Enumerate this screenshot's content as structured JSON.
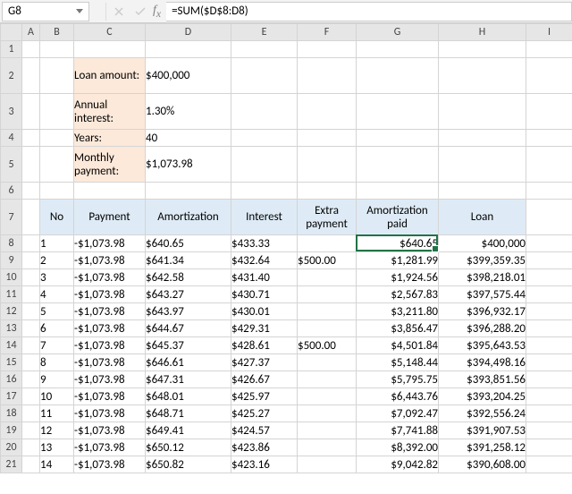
{
  "name_box": "G8",
  "formula": "=SUM($D$8:D8)",
  "col_hdrs": [
    "A",
    "B",
    "C",
    "D",
    "E",
    "F",
    "G",
    "H",
    "I"
  ],
  "summary": {
    "loan_amount_label": "Loan amount:",
    "loan_amount": "$400,000",
    "annual_interest_label": "Annual interest:",
    "annual_interest": "1.30%",
    "years_label": "Years:",
    "years": "40",
    "monthly_payment_label": "Monthly payment:",
    "monthly_payment": "$1,073.98"
  },
  "headers": {
    "no": "No",
    "payment": "Payment",
    "amortization": "Amortization",
    "interest": "Interest",
    "extra_payment": "Extra payment",
    "amortization_paid": "Amortization paid",
    "loan": "Loan"
  },
  "rows": [
    {
      "r": "8",
      "no": "1",
      "payment": "-$1,073.98",
      "amort": "$640.65",
      "interest": "$433.33",
      "extra": "",
      "paid": "$640.65",
      "loan": "$400,000"
    },
    {
      "r": "9",
      "no": "2",
      "payment": "-$1,073.98",
      "amort": "$641.34",
      "interest": "$432.64",
      "extra": "$500.00",
      "paid": "$1,281.99",
      "loan": "$399,359.35"
    },
    {
      "r": "10",
      "no": "3",
      "payment": "-$1,073.98",
      "amort": "$642.58",
      "interest": "$431.40",
      "extra": "",
      "paid": "$1,924.56",
      "loan": "$398,218.01"
    },
    {
      "r": "11",
      "no": "4",
      "payment": "-$1,073.98",
      "amort": "$643.27",
      "interest": "$430.71",
      "extra": "",
      "paid": "$2,567.83",
      "loan": "$397,575.44"
    },
    {
      "r": "12",
      "no": "5",
      "payment": "-$1,073.98",
      "amort": "$643.97",
      "interest": "$430.01",
      "extra": "",
      "paid": "$3,211.80",
      "loan": "$396,932.17"
    },
    {
      "r": "13",
      "no": "6",
      "payment": "-$1,073.98",
      "amort": "$644.67",
      "interest": "$429.31",
      "extra": "",
      "paid": "$3,856.47",
      "loan": "$396,288.20"
    },
    {
      "r": "14",
      "no": "7",
      "payment": "-$1,073.98",
      "amort": "$645.37",
      "interest": "$428.61",
      "extra": "$500.00",
      "paid": "$4,501.84",
      "loan": "$395,643.53"
    },
    {
      "r": "15",
      "no": "8",
      "payment": "-$1,073.98",
      "amort": "$646.61",
      "interest": "$427.37",
      "extra": "",
      "paid": "$5,148.44",
      "loan": "$394,498.16"
    },
    {
      "r": "16",
      "no": "9",
      "payment": "-$1,073.98",
      "amort": "$647.31",
      "interest": "$426.67",
      "extra": "",
      "paid": "$5,795.75",
      "loan": "$393,851.56"
    },
    {
      "r": "17",
      "no": "10",
      "payment": "-$1,073.98",
      "amort": "$648.01",
      "interest": "$425.97",
      "extra": "",
      "paid": "$6,443.76",
      "loan": "$393,204.25"
    },
    {
      "r": "18",
      "no": "11",
      "payment": "-$1,073.98",
      "amort": "$648.71",
      "interest": "$425.27",
      "extra": "",
      "paid": "$7,092.47",
      "loan": "$392,556.24"
    },
    {
      "r": "19",
      "no": "12",
      "payment": "-$1,073.98",
      "amort": "$649.41",
      "interest": "$424.57",
      "extra": "",
      "paid": "$7,741.88",
      "loan": "$391,907.53"
    },
    {
      "r": "20",
      "no": "13",
      "payment": "-$1,073.98",
      "amort": "$650.12",
      "interest": "$423.86",
      "extra": "",
      "paid": "$8,392.00",
      "loan": "$391,258.12"
    },
    {
      "r": "21",
      "no": "14",
      "payment": "-$1,073.98",
      "amort": "$650.82",
      "interest": "$423.16",
      "extra": "",
      "paid": "$9,042.82",
      "loan": "$390,608.00"
    }
  ]
}
